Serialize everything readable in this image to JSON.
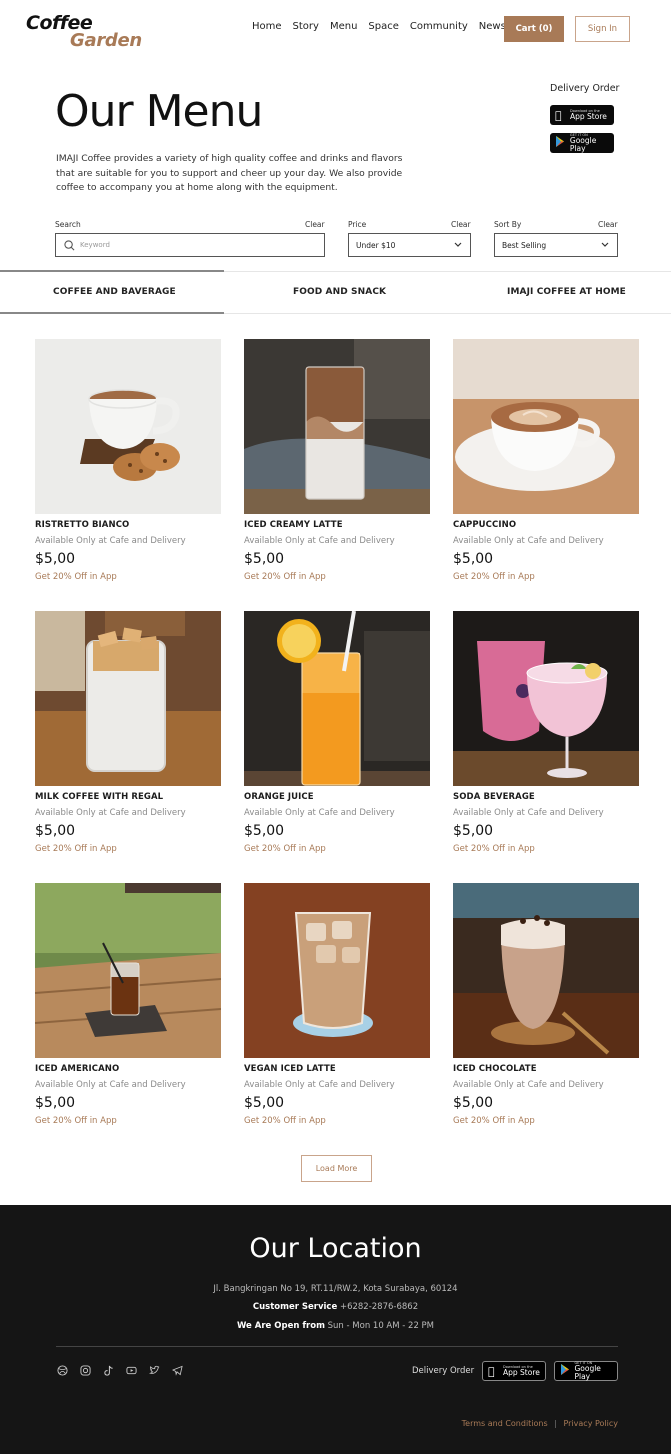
{
  "brand": {
    "line1": "Coffee",
    "line2": "Garden"
  },
  "nav": [
    "Home",
    "Story",
    "Menu",
    "Space",
    "Community",
    "News"
  ],
  "header": {
    "cart_label": "Cart (0)",
    "signin_label": "Sign In"
  },
  "hero": {
    "title": "Our Menu",
    "intro": "IMAJI Coffee provides a variety of high quality coffee and drinks and flavors that are suitable for you to support and cheer up your day. We also provide coffee to accompany you at home along with the equipment.",
    "delivery_label": "Delivery Order",
    "appstore": {
      "small": "Download on the",
      "big": "App Store"
    },
    "googleplay": {
      "small": "GET IT ON",
      "big": "Google Play"
    }
  },
  "filters": {
    "search_label": "Search",
    "search_clear": "Clear",
    "search_placeholder": "Keyword",
    "price_label": "Price",
    "price_clear": "Clear",
    "price_value": "Under $10",
    "sort_label": "Sort By",
    "sort_clear": "Clear",
    "sort_value": "Best Selling"
  },
  "tabs": [
    "COFFEE AND BAVERAGE",
    "FOOD AND SNACK",
    "IMAJI COFFEE AT HOME"
  ],
  "products": [
    {
      "name": "RISTRETTO BIANCO",
      "avail": "Available Only at Cafe and Delivery",
      "price": "$5,00",
      "promo": "Get 20% Off in App"
    },
    {
      "name": "ICED CREAMY LATTE",
      "avail": "Available Only at Cafe and Delivery",
      "price": "$5,00",
      "promo": "Get 20% Off in App"
    },
    {
      "name": "CAPPUCCINO",
      "avail": "Available Only at Cafe and Delivery",
      "price": "$5,00",
      "promo": "Get 20% Off in App"
    },
    {
      "name": "MILK COFFEE WITH REGAL",
      "avail": "Available Only at Cafe and Delivery",
      "price": "$5,00",
      "promo": "Get 20% Off in App"
    },
    {
      "name": "ORANGE JUICE",
      "avail": "Available Only at Cafe and Delivery",
      "price": "$5,00",
      "promo": "Get 20% Off in App"
    },
    {
      "name": "SODA BEVERAGE",
      "avail": "Available Only at Cafe and Delivery",
      "price": "$5,00",
      "promo": "Get 20% Off in App"
    },
    {
      "name": "ICED AMERICANO",
      "avail": "Available Only at Cafe and Delivery",
      "price": "$5,00",
      "promo": "Get 20% Off in App"
    },
    {
      "name": "VEGAN ICED LATTE",
      "avail": "Available Only at Cafe and Delivery",
      "price": "$5,00",
      "promo": "Get 20% Off in App"
    },
    {
      "name": "ICED CHOCOLATE",
      "avail": "Available Only at Cafe and Delivery",
      "price": "$5,00",
      "promo": "Get 20% Off in App"
    }
  ],
  "load_more": "Load More",
  "footer": {
    "title": "Our Location",
    "address": "Jl. Bangkringan No 19, RT.11/RW.2, Kota Surabaya, 60124",
    "service_label": "Customer Service",
    "service_value": "+6282-2876-6862",
    "hours_label": "We Are Open from",
    "hours_value": "Sun - Mon 10 AM - 22 PM",
    "delivery_label": "Delivery Order",
    "appstore": {
      "small": "Download on the",
      "big": "App Store"
    },
    "googleplay": {
      "small": "GET IT ON",
      "big": "Google Play"
    },
    "terms": "Terms and Conditions",
    "separator": "|",
    "privacy": "Privacy Policy"
  },
  "social_icons": [
    "dribbble-icon",
    "instagram-icon",
    "tiktok-icon",
    "youtube-icon",
    "twitter-icon",
    "telegram-icon"
  ],
  "colors": {
    "accent": "#a87a57",
    "footer_bg": "#151515"
  }
}
